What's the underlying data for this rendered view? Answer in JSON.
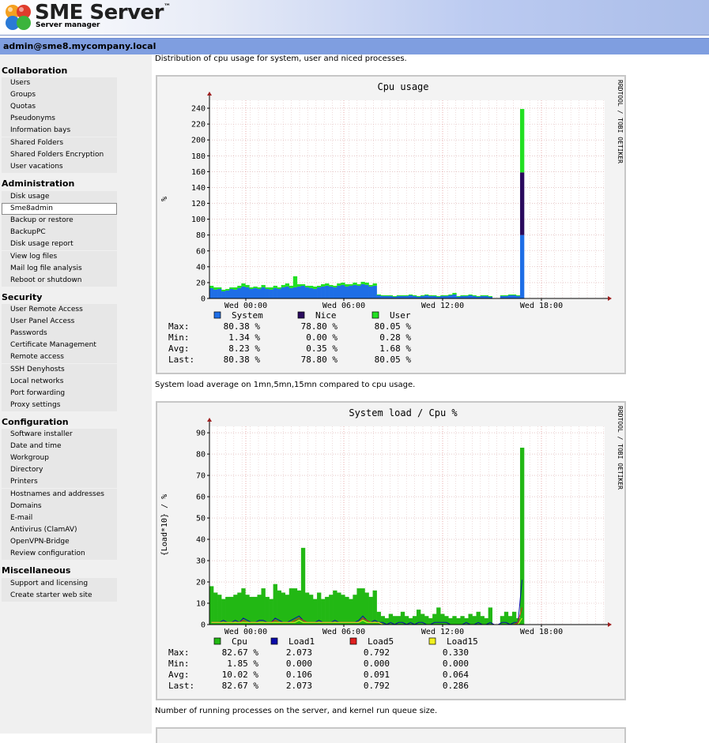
{
  "header": {
    "logo_title": "SME Server",
    "logo_tm": "™",
    "logo_subtitle": "Server manager"
  },
  "userbar": {
    "user": "admin@sme8.mycompany.local"
  },
  "nav": {
    "collaboration": {
      "heading": "Collaboration",
      "items": [
        "Users",
        "Groups",
        "Quotas",
        "Pseudonyms",
        "Information bays",
        "Shared Folders",
        "Shared Folders Encryption",
        "User vacations"
      ]
    },
    "administration": {
      "heading": "Administration",
      "items": [
        "Disk usage",
        "Sme8admin",
        "Backup or restore",
        "BackupPC",
        "Disk usage report",
        "View log files",
        "Mail log file analysis",
        "Reboot or shutdown"
      ]
    },
    "security": {
      "heading": "Security",
      "items": [
        "User Remote Access",
        "User Panel Access",
        "Passwords",
        "Certificate Management",
        "Remote access",
        "SSH Denyhosts",
        "Local networks",
        "Port forwarding",
        "Proxy settings"
      ]
    },
    "configuration": {
      "heading": "Configuration",
      "items": [
        "Software installer",
        "Date and time",
        "Workgroup",
        "Directory",
        "Printers",
        "Hostnames and addresses",
        "Domains",
        "E-mail",
        "Antivirus (ClamAV)",
        "OpenVPN-Bridge",
        "Review configuration"
      ]
    },
    "miscellaneous": {
      "heading": "Miscellaneous",
      "items": [
        "Support and licensing",
        "Create starter web site"
      ]
    }
  },
  "main": {
    "desc1": "Distribution of cpu usage for system, user and niced processes.",
    "desc2": "System load average on 1mn,5mn,15mn compared to cpu usage.",
    "desc3": "Number of running processes on the server, and kernel run queue size."
  },
  "colors": {
    "system": "#1e6ee6",
    "nice": "#2a0a5e",
    "user": "#22e022",
    "cpu": "#22b814",
    "load1": "#0a0aa8",
    "load5": "#e02020",
    "load15": "#f0f020"
  },
  "chart_data": [
    {
      "type": "area",
      "title": "Cpu usage",
      "ylabel": "%",
      "watermark": "RRDTOOL / TOBI OETIKER",
      "ylim": [
        0,
        250
      ],
      "yticks": [
        0,
        20,
        40,
        60,
        80,
        100,
        120,
        140,
        160,
        180,
        200,
        220,
        240
      ],
      "xtick_labels": [
        "Wed 00:00",
        "Wed 06:00",
        "Wed 12:00",
        "Wed 18:00"
      ],
      "series": [
        {
          "name": "System",
          "stack": true,
          "values": [
            13,
            11,
            12,
            9,
            10,
            12,
            11,
            13,
            15,
            14,
            12,
            13,
            12,
            14,
            12,
            11,
            13,
            12,
            14,
            15,
            13,
            14,
            15,
            16,
            14,
            13,
            12,
            14,
            15,
            16,
            15,
            14,
            16,
            17,
            15,
            16,
            17,
            16,
            18,
            17,
            15,
            16,
            4,
            3,
            3,
            3,
            2,
            3,
            3,
            3,
            4,
            3,
            2,
            3,
            4,
            3,
            3,
            2,
            3,
            3,
            4,
            5,
            2,
            3,
            3,
            4,
            3,
            2,
            3,
            3,
            2,
            0,
            0,
            3,
            3,
            4,
            4,
            3,
            80
          ]
        },
        {
          "name": "Nice",
          "stack": true,
          "values": [
            0,
            0,
            0,
            0,
            0,
            0,
            0,
            0,
            0,
            0,
            0,
            0,
            0,
            0,
            0,
            0,
            0,
            0,
            0,
            0,
            0,
            0,
            0,
            0,
            0,
            0,
            0,
            0,
            0,
            0,
            0,
            0,
            0,
            0,
            0,
            0,
            0,
            0,
            0,
            0,
            0,
            0,
            0,
            0,
            0,
            0,
            0,
            0,
            0,
            0,
            0,
            0,
            0,
            0,
            0,
            0,
            0,
            0,
            0,
            0,
            0,
            0,
            0,
            0,
            0,
            0,
            0,
            0,
            0,
            0,
            0,
            0,
            0,
            0,
            0,
            0,
            0,
            0,
            79
          ]
        },
        {
          "name": "User",
          "stack": true,
          "values": [
            3,
            3,
            2,
            2,
            2,
            2,
            3,
            3,
            4,
            3,
            2,
            2,
            2,
            3,
            2,
            3,
            3,
            2,
            3,
            4,
            3,
            14,
            3,
            2,
            2,
            3,
            3,
            2,
            3,
            3,
            2,
            2,
            3,
            3,
            3,
            2,
            3,
            2,
            3,
            3,
            2,
            3,
            1,
            1,
            1,
            1,
            1,
            1,
            1,
            1,
            1,
            1,
            1,
            1,
            1,
            1,
            1,
            1,
            1,
            1,
            1,
            2,
            1,
            1,
            1,
            1,
            1,
            1,
            1,
            1,
            1,
            0,
            0,
            1,
            1,
            1,
            1,
            1,
            80
          ]
        }
      ],
      "legend_placement": "bottom",
      "stats_labels": [
        "Max:",
        "Min:",
        "Avg:",
        "Last:"
      ],
      "stats": [
        {
          "series": "System",
          "values": [
            "80.38 %",
            "1.34 %",
            "8.23 %",
            "80.38 %"
          ]
        },
        {
          "series": "Nice",
          "values": [
            "78.80 %",
            "0.00 %",
            "0.35 %",
            "78.80 %"
          ]
        },
        {
          "series": "User",
          "values": [
            "80.05 %",
            "0.28 %",
            "1.68 %",
            "80.05 %"
          ]
        }
      ]
    },
    {
      "type": "area",
      "title": "System load / Cpu %",
      "ylabel": "{Load*10} / %",
      "watermark": "RRDTOOL / TOBI OETIKER",
      "ylim": [
        0,
        93
      ],
      "yticks": [
        0,
        10,
        20,
        30,
        40,
        50,
        60,
        70,
        80,
        90
      ],
      "xtick_labels": [
        "Wed 00:00",
        "Wed 06:00",
        "Wed 12:00",
        "Wed 18:00"
      ],
      "series": [
        {
          "name": "Cpu",
          "values": [
            18,
            15,
            14,
            12,
            13,
            13,
            14,
            15,
            17,
            14,
            13,
            13,
            14,
            17,
            13,
            12,
            19,
            16,
            15,
            14,
            17,
            17,
            16,
            36,
            15,
            14,
            12,
            15,
            12,
            13,
            14,
            16,
            15,
            14,
            13,
            12,
            14,
            17,
            17,
            15,
            13,
            16,
            6,
            4,
            3,
            5,
            4,
            4,
            6,
            4,
            3,
            4,
            7,
            5,
            4,
            3,
            5,
            8,
            5,
            4,
            3,
            4,
            3,
            4,
            3,
            5,
            4,
            6,
            4,
            3,
            8,
            0,
            0,
            4,
            6,
            4,
            6,
            3,
            83
          ]
        },
        {
          "name": "Load1",
          "values": [
            1,
            1,
            1,
            2,
            1,
            1,
            2,
            1,
            3,
            2,
            1,
            1,
            2,
            2,
            1,
            1,
            3,
            2,
            1,
            1,
            2,
            3,
            4,
            2,
            1,
            1,
            1,
            2,
            1,
            1,
            1,
            2,
            1,
            1,
            1,
            1,
            1,
            2,
            4,
            2,
            1,
            2,
            1,
            1,
            0,
            1,
            0,
            1,
            1,
            0,
            1,
            0,
            1,
            1,
            0,
            0,
            1,
            1,
            1,
            1,
            0,
            0,
            0,
            0,
            1,
            0,
            0,
            1,
            0,
            0,
            1,
            0,
            0,
            1,
            1,
            0,
            1,
            1,
            21
          ]
        },
        {
          "name": "Load5",
          "values": [
            1,
            1,
            1,
            1,
            1,
            1,
            1,
            1,
            2,
            1,
            1,
            1,
            1,
            1,
            1,
            1,
            2,
            1,
            1,
            1,
            1,
            2,
            3,
            2,
            1,
            1,
            1,
            1,
            1,
            1,
            1,
            1,
            1,
            1,
            1,
            1,
            1,
            1,
            3,
            2,
            1,
            1,
            1,
            0,
            0,
            0,
            0,
            0,
            0,
            0,
            0,
            0,
            0,
            0,
            0,
            0,
            0,
            0,
            0,
            0,
            0,
            0,
            0,
            0,
            0,
            0,
            0,
            0,
            0,
            0,
            0,
            0,
            0,
            0,
            0,
            0,
            0,
            1,
            8
          ]
        },
        {
          "name": "Load15",
          "values": [
            1,
            1,
            1,
            1,
            1,
            1,
            1,
            1,
            1,
            1,
            1,
            1,
            1,
            1,
            1,
            1,
            1,
            1,
            1,
            1,
            1,
            1,
            2,
            1,
            1,
            1,
            1,
            1,
            1,
            1,
            1,
            1,
            1,
            1,
            1,
            1,
            1,
            1,
            2,
            1,
            1,
            1,
            1,
            0,
            0,
            0,
            0,
            0,
            0,
            0,
            0,
            0,
            0,
            0,
            0,
            0,
            0,
            0,
            0,
            0,
            0,
            0,
            0,
            0,
            0,
            0,
            0,
            0,
            0,
            0,
            0,
            0,
            0,
            0,
            0,
            0,
            0,
            0,
            3
          ]
        }
      ],
      "legend_placement": "bottom",
      "stats_labels": [
        "Max:",
        "Min:",
        "Avg:",
        "Last:"
      ],
      "stats": [
        {
          "series": "Cpu",
          "values": [
            "82.67 %",
            "1.85 %",
            "10.02 %",
            "82.67 %"
          ]
        },
        {
          "series": "Load1",
          "values": [
            "2.073",
            "0.000",
            "0.106",
            "2.073"
          ]
        },
        {
          "series": "Load5",
          "values": [
            "0.792",
            "0.000",
            "0.091",
            "0.792"
          ]
        },
        {
          "series": "Load15",
          "values": [
            "0.330",
            "0.000",
            "0.064",
            "0.286"
          ]
        }
      ]
    }
  ]
}
